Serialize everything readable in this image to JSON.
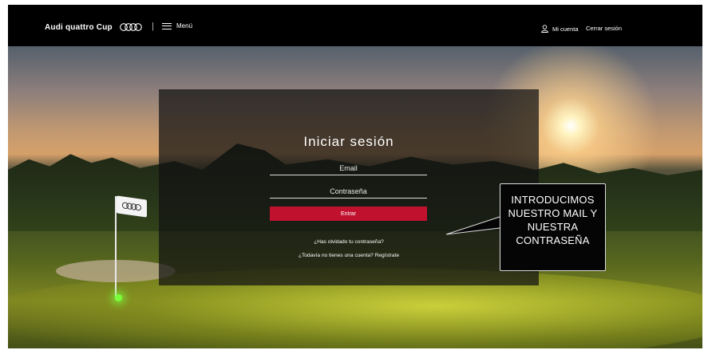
{
  "header": {
    "brand": "Audi quattro Cup",
    "separator": "|",
    "menu_label": "Menú",
    "account_label": "Mi cuenta",
    "logout_label": "Cerrar sesión"
  },
  "login": {
    "title": "Iniciar sesión",
    "email_placeholder": "Email",
    "password_placeholder": "Contraseña",
    "submit_label": "Entrar",
    "forgot_password": "¿Has olvidado tu contraseña?",
    "register_prompt": "¿Todavía no tienes una cuenta? Regístrate"
  },
  "callout": {
    "lines": [
      "INTRODUCIMOS",
      "NUESTRO MAIL Y",
      "NUESTRA",
      "CONTRASEÑA"
    ]
  },
  "colors": {
    "header_bg": "#000000",
    "submit_bg": "#c0122f",
    "panel_bg": "rgba(18,18,18,0.72)"
  },
  "icons": {
    "brand_logo": "audi-rings-icon",
    "menu": "hamburger-icon",
    "account": "user-icon"
  }
}
